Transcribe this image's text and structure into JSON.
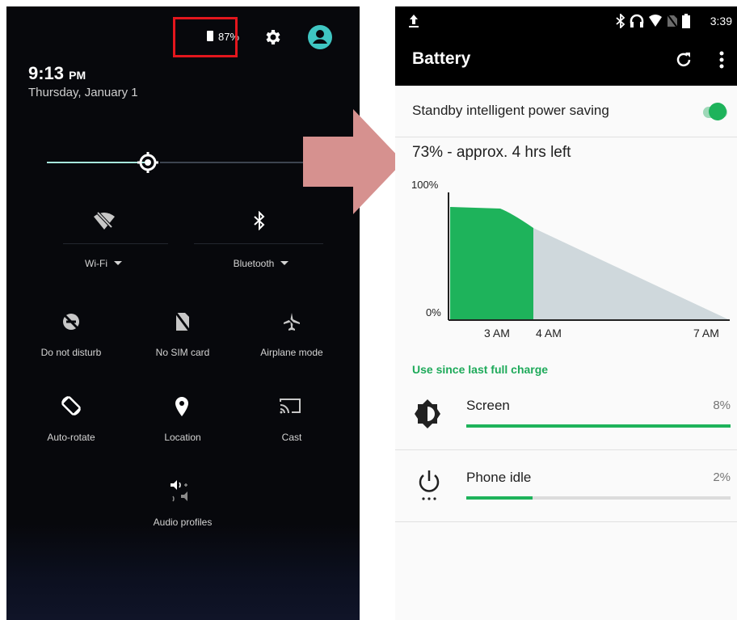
{
  "left_panel": {
    "battery_percent": "87%",
    "time": "9:13",
    "time_suffix": "PM",
    "date": "Thursday, January 1",
    "brightness_level": 0.38,
    "tiles_row1": [
      {
        "icon": "wifi-off-icon",
        "label": "Wi-Fi"
      },
      {
        "icon": "bluetooth-icon",
        "label": "Bluetooth"
      }
    ],
    "tiles_row2": [
      {
        "icon": "do-not-disturb-icon",
        "label": "Do not disturb"
      },
      {
        "icon": "no-sim-icon",
        "label": "No SIM card"
      },
      {
        "icon": "airplane-icon",
        "label": "Airplane mode"
      }
    ],
    "tiles_row3": [
      {
        "icon": "auto-rotate-icon",
        "label": "Auto-rotate"
      },
      {
        "icon": "location-icon",
        "label": "Location"
      },
      {
        "icon": "cast-icon",
        "label": "Cast"
      }
    ],
    "tiles_row4": [
      {
        "icon": "audio-profiles-icon",
        "label": "Audio profiles"
      }
    ],
    "highlight_color": "#e3161d"
  },
  "right_panel": {
    "status_time": "3:39",
    "app_title": "Battery",
    "standby_label": "Standby intelligent power saving",
    "standby_enabled": true,
    "summary": "73% - approx. 4 hrs left",
    "chart": {
      "y_top": "100%",
      "y_bottom": "0%",
      "x_ticks": [
        "3 AM",
        "4 AM",
        "7 AM"
      ]
    },
    "section_title": "Use since last full charge",
    "usage": [
      {
        "icon": "screen-brightness-icon",
        "label": "Screen",
        "percent": "8%",
        "fraction": 0.08
      },
      {
        "icon": "power-icon",
        "label": "Phone idle",
        "percent": "2%",
        "fraction": 0.02
      }
    ],
    "accent_color": "#1eb35b"
  },
  "chart_data": {
    "type": "area",
    "title": "",
    "xlabel": "",
    "ylabel": "",
    "x_ticks": [
      "3 AM",
      "4 AM",
      "7 AM"
    ],
    "ylim": [
      0,
      100
    ],
    "series": [
      {
        "values_x": [
          "start",
          "3 AM",
          "4 AM"
        ],
        "values": [
          88,
          85,
          73
        ]
      },
      {
        "values_x": [
          "4 AM",
          "7 AM"
        ],
        "values": [
          73,
          0
        ]
      }
    ]
  }
}
